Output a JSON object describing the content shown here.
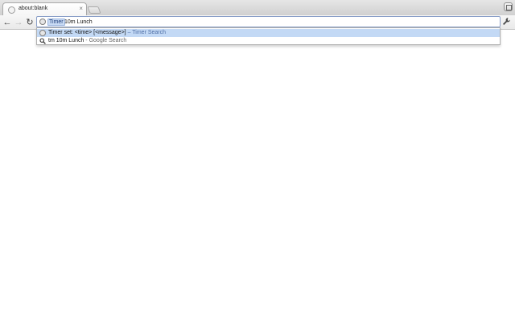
{
  "tab": {
    "title": "about:blank",
    "close": "×",
    "favicon": "page-icon"
  },
  "toolbar": {
    "back": "←",
    "forward": "→",
    "reload": "↻",
    "wrench": "🔧"
  },
  "omnibox": {
    "keyword_icon": "timer-icon",
    "keyword": "Timer",
    "text": "10m Lunch"
  },
  "suggestions": [
    {
      "icon": "timer-icon",
      "text": "Timer set: <time> [<message>]",
      "separator": " – ",
      "desc": "Timer Search"
    },
    {
      "icon": "search-icon",
      "text": "tm 10m Lunch",
      "separator": " - ",
      "desc": "Google Search"
    }
  ]
}
